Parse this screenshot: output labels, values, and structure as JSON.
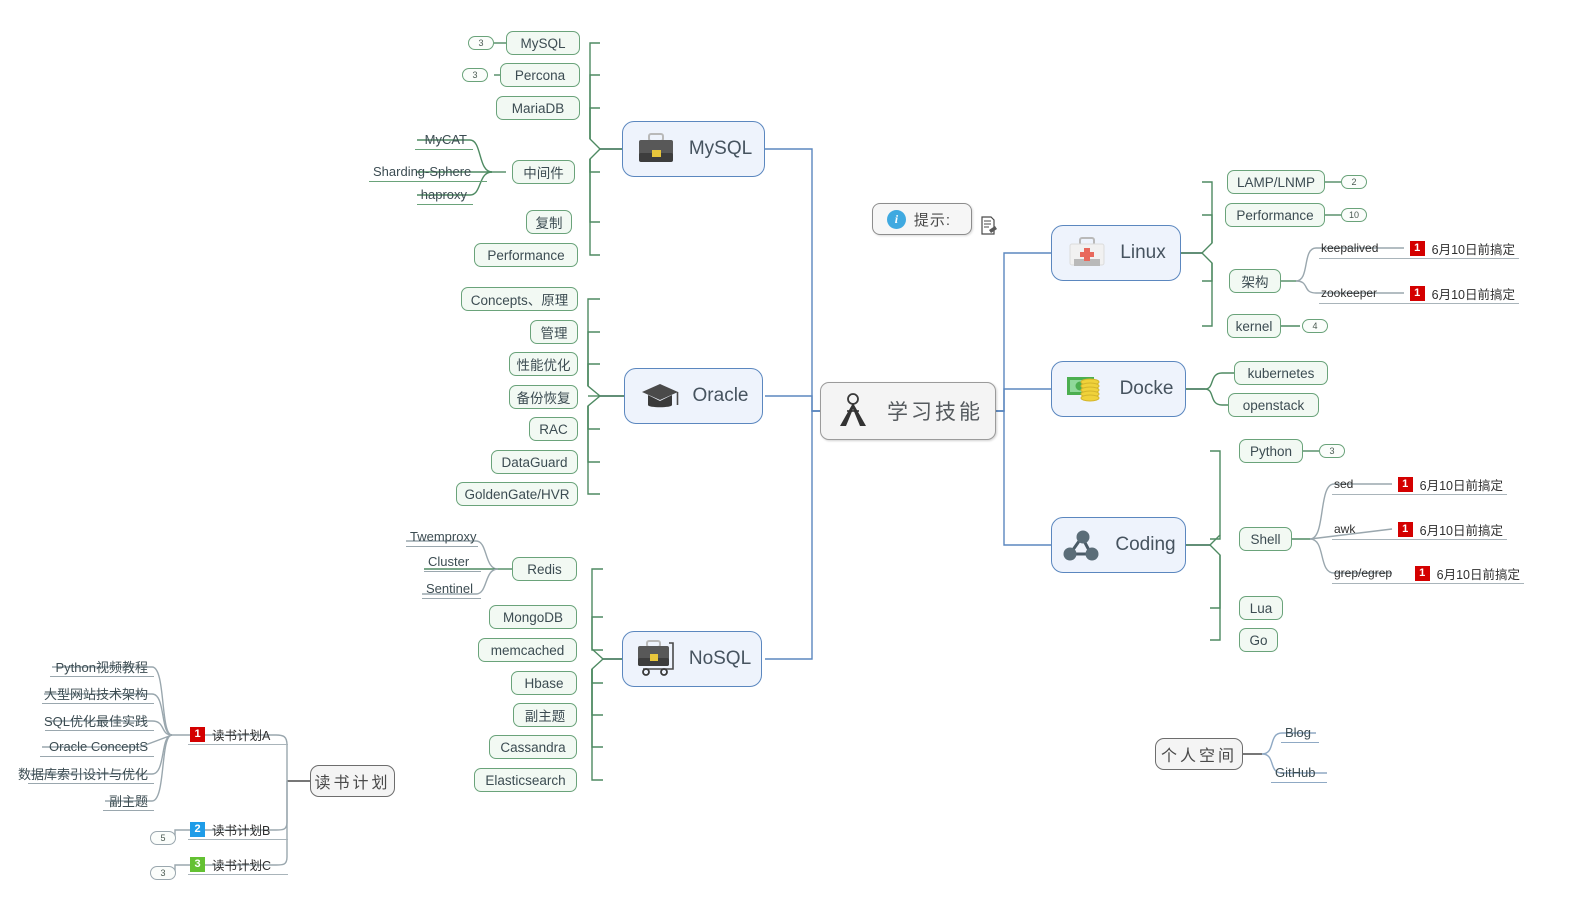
{
  "root": {
    "label": "学习技能",
    "icon": "compass-icon"
  },
  "hint": {
    "label": "提示:",
    "icon": "info-icon"
  },
  "main_branches": [
    {
      "id": "mysql",
      "label": "MySQL",
      "icon": "briefcase-icon"
    },
    {
      "id": "oracle",
      "label": "Oracle",
      "icon": "graduation-cap-icon"
    },
    {
      "id": "nosql",
      "label": "NoSQL",
      "icon": "trolley-briefcase-icon"
    },
    {
      "id": "linux",
      "label": "Linux",
      "icon": "first-aid-kit-icon"
    },
    {
      "id": "docker",
      "label": "Docke",
      "icon": "money-coins-icon"
    },
    {
      "id": "coding",
      "label": "Coding",
      "icon": "network-nodes-icon"
    }
  ],
  "mysql": {
    "children": [
      {
        "label": "MySQL",
        "counter": "3"
      },
      {
        "label": "Percona",
        "counter": "3"
      },
      {
        "label": "MariaDB",
        "counter": ""
      },
      {
        "label": "中间件",
        "counter": ""
      },
      {
        "label": "复制",
        "counter": ""
      },
      {
        "label": "Performance",
        "counter": ""
      }
    ],
    "middleware_children": [
      {
        "label": "MyCAT"
      },
      {
        "label": "Sharding-Sphere"
      },
      {
        "label": "haproxy"
      }
    ]
  },
  "oracle": {
    "children": [
      {
        "label": "Concepts、原理"
      },
      {
        "label": "管理"
      },
      {
        "label": "性能优化"
      },
      {
        "label": "备份恢复"
      },
      {
        "label": "RAC"
      },
      {
        "label": "DataGuard"
      },
      {
        "label": "GoldenGate/HVR"
      }
    ]
  },
  "nosql": {
    "children": [
      {
        "label": "Redis"
      },
      {
        "label": "MongoDB"
      },
      {
        "label": "memcached"
      },
      {
        "label": "Hbase"
      },
      {
        "label": "副主题"
      },
      {
        "label": "Cassandra"
      },
      {
        "label": "Elasticsearch"
      }
    ],
    "redis_children": [
      {
        "label": "Twemproxy"
      },
      {
        "label": "Cluster"
      },
      {
        "label": "Sentinel"
      }
    ]
  },
  "linux": {
    "children": [
      {
        "label": "LAMP/LNMP",
        "counter": "2"
      },
      {
        "label": "Performance",
        "counter": "10"
      },
      {
        "label": "架构",
        "counter": ""
      },
      {
        "label": "kernel",
        "counter": "4"
      }
    ],
    "arch_children": [
      {
        "label": "keepalived",
        "priority": "1",
        "task": "6月10日前搞定"
      },
      {
        "label": "zookeeper",
        "priority": "1",
        "task": "6月10日前搞定"
      }
    ]
  },
  "docker": {
    "children": [
      {
        "label": "kubernetes"
      },
      {
        "label": "openstack"
      }
    ]
  },
  "coding": {
    "children": [
      {
        "label": "Python",
        "counter": "3"
      },
      {
        "label": "Shell",
        "counter": ""
      },
      {
        "label": "Lua",
        "counter": ""
      },
      {
        "label": "Go",
        "counter": ""
      }
    ],
    "shell_children": [
      {
        "label": "sed",
        "priority": "1",
        "task": "6月10日前搞定"
      },
      {
        "label": "awk",
        "priority": "1",
        "task": "6月10日前搞定"
      },
      {
        "label": "grep/egrep",
        "priority": "1",
        "task": "6月10日前搞定"
      }
    ]
  },
  "reading_plan": {
    "title": "读书计划",
    "plans": [
      {
        "label": "读书计划A",
        "priority": "1",
        "counter": ""
      },
      {
        "label": "读书计划B",
        "priority": "2",
        "counter": "5"
      },
      {
        "label": "读书计划C",
        "priority": "3",
        "counter": "3"
      }
    ],
    "plan_a_books": [
      {
        "label": "Python视频教程"
      },
      {
        "label": "大型网站技术架构"
      },
      {
        "label": "SQL优化最佳实践"
      },
      {
        "label": "Oracle ConceptS"
      },
      {
        "label": "数据库索引设计与优化"
      },
      {
        "label": "副主题"
      }
    ]
  },
  "personal_space": {
    "title": "个人空间",
    "children": [
      {
        "label": "Blog"
      },
      {
        "label": "GitHub"
      }
    ]
  },
  "colors": {
    "main_border": "#5b87bf",
    "main_fill": "#eef3fc",
    "pill_border": "#6aa37a",
    "pill_fill": "#f2f9f3",
    "link_blue": "#5b87bf",
    "link_green": "#4e8a62",
    "link_grey": "#9aa7ae",
    "prio1": "#d40000",
    "prio2": "#1e9ce8",
    "prio3": "#63c132"
  }
}
